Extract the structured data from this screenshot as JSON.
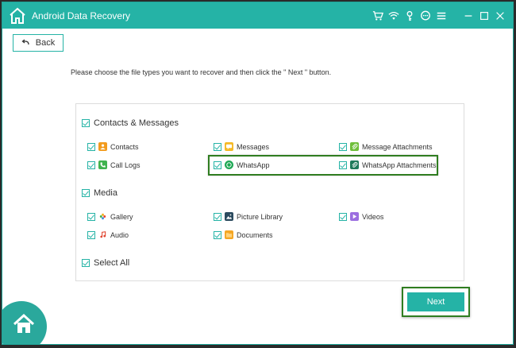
{
  "app": {
    "title": "Android Data Recovery"
  },
  "toolbar": {
    "icons": [
      "cart-icon",
      "wifi-icon",
      "key-icon",
      "chat-icon",
      "menu-icon",
      "minimize-icon",
      "maximize-icon",
      "close-icon"
    ]
  },
  "back": {
    "label": "Back"
  },
  "instruction": "Please choose the file types you want to recover and then click the \" Next \" button.",
  "groups": {
    "contacts_messages": {
      "label": "Contacts & Messages",
      "items": {
        "contacts": "Contacts",
        "messages": "Messages",
        "message_attachments": "Message Attachments",
        "call_logs": "Call Logs",
        "whatsapp": "WhatsApp",
        "whatsapp_attachments": "WhatsApp Attachments"
      }
    },
    "media": {
      "label": "Media",
      "items": {
        "gallery": "Gallery",
        "picture_library": "Picture Library",
        "videos": "Videos",
        "audio": "Audio",
        "documents": "Documents"
      }
    }
  },
  "select_all": {
    "label": "Select All"
  },
  "next": {
    "label": "Next"
  },
  "colors": {
    "accent": "#25b3a6",
    "highlight": "#2f7d20"
  }
}
